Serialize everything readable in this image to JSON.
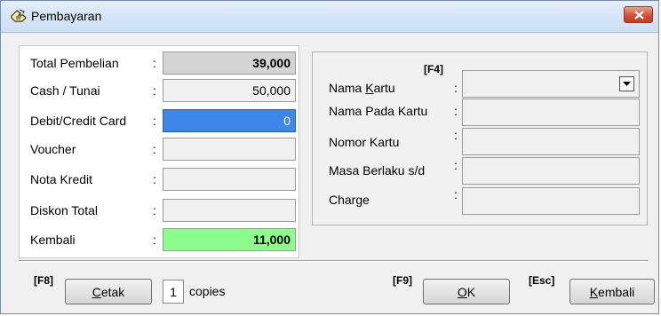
{
  "window": {
    "title": "Pembayaran"
  },
  "left_panel": {
    "rows": [
      {
        "label": "Total Pembelian",
        "colon": ":",
        "value": "39,000"
      },
      {
        "label": "Cash / Tunai",
        "colon": ":",
        "value": "50,000"
      },
      {
        "label": "Debit/Credit Card",
        "colon": ":",
        "value": "0"
      },
      {
        "label": "Voucher",
        "colon": ":",
        "value": ""
      },
      {
        "label": "Nota Kredit",
        "colon": ":",
        "value": ""
      },
      {
        "label": "Diskon Total",
        "colon": ":",
        "value": ""
      },
      {
        "label": "Kembali",
        "colon": ":",
        "value": "11,000"
      }
    ]
  },
  "right_panel": {
    "hotkey": "[F4]",
    "nama_kartu": {
      "label_pre": "Nama ",
      "label_u": "K",
      "label_post": "artu",
      "colon": ":",
      "selected": ""
    },
    "rows": [
      {
        "label": "Nama Pada Kartu",
        "colon": ":",
        "value": ""
      },
      {
        "label": "Nomor Kartu",
        "colon": ":",
        "value": ""
      },
      {
        "label": "Masa Berlaku s/d",
        "colon": ":",
        "value": ""
      },
      {
        "label": "Charge",
        "colon": ":",
        "value": ""
      }
    ]
  },
  "footer": {
    "print_hotkey": "[F8]",
    "print_button": {
      "u": "C",
      "rest": "etak"
    },
    "copies_value": "1",
    "copies_label": "copies",
    "ok_hotkey": "[F9]",
    "ok_button": {
      "u": "O",
      "rest": "K"
    },
    "back_hotkey": "[Esc]",
    "back_button": {
      "u": "K",
      "rest": "embali"
    }
  },
  "colors": {
    "total_field": "#d4d4d4",
    "active_field": "#3d86ea",
    "change_field": "#8cfc8c",
    "close_button": "#d3573b"
  },
  "icons": {
    "title": "payment-hand-icon",
    "close": "close-icon",
    "dropdown": "chevron-down-icon"
  }
}
